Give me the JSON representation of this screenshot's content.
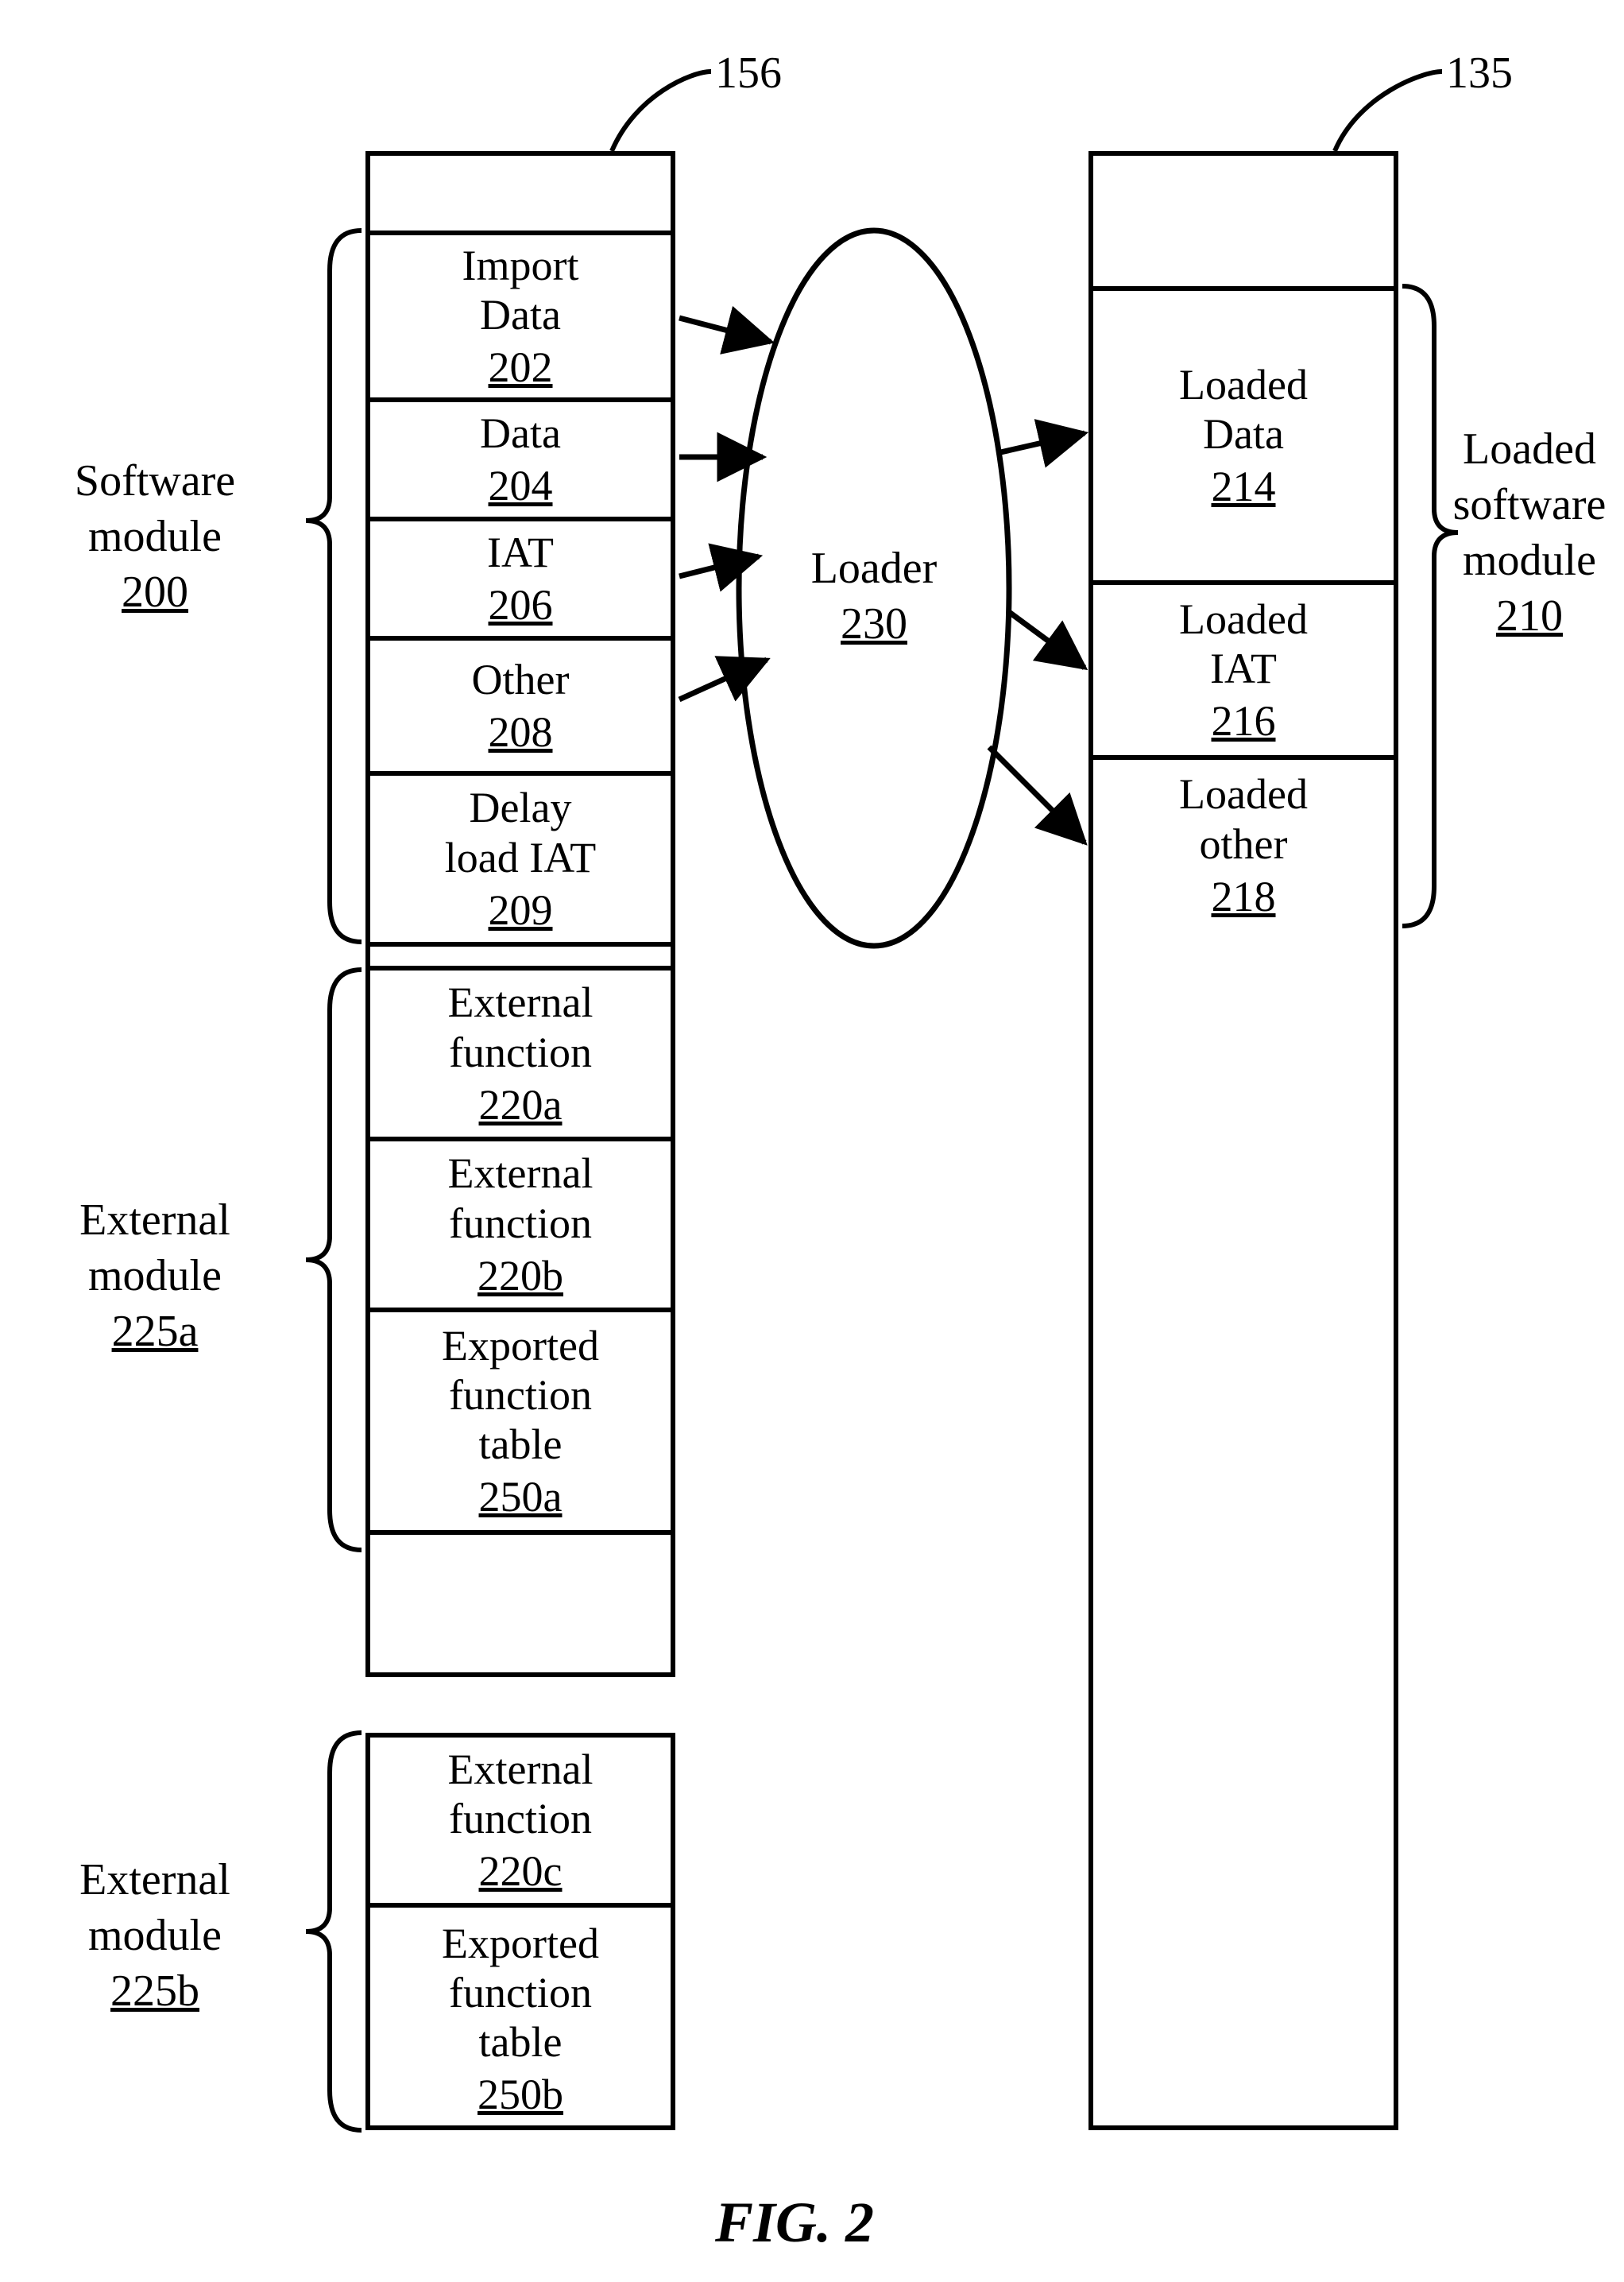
{
  "figure_label": "FIG. 2",
  "callouts": {
    "left_top": "156",
    "right_top": "135"
  },
  "loader": {
    "label": "Loader",
    "ref": "230"
  },
  "side_labels": {
    "software_module": {
      "text": "Software\nmodule",
      "ref": "200"
    },
    "external_module_a": {
      "text": "External\nmodule",
      "ref": "225a"
    },
    "external_module_b": {
      "text": "External\nmodule",
      "ref": "225b"
    },
    "loaded_software_module": {
      "text": "Loaded\nsoftware\nmodule",
      "ref": "210"
    }
  },
  "left_column": {
    "sw": [
      {
        "label": "Import\nData",
        "ref": "202"
      },
      {
        "label": "Data",
        "ref": "204"
      },
      {
        "label": "IAT",
        "ref": "206"
      },
      {
        "label": "Other",
        "ref": "208"
      },
      {
        "label": "Delay\nload IAT",
        "ref": "209"
      }
    ],
    "ext_a": [
      {
        "label": "External\nfunction",
        "ref": "220a"
      },
      {
        "label": "External\nfunction",
        "ref": "220b"
      },
      {
        "label": "Exported\nfunction\ntable",
        "ref": "250a"
      }
    ],
    "ext_b": [
      {
        "label": "External\nfunction",
        "ref": "220c"
      },
      {
        "label": "Exported\nfunction\ntable",
        "ref": "250b"
      }
    ]
  },
  "right_column": {
    "cells": [
      {
        "label": "Loaded\nData",
        "ref": "214"
      },
      {
        "label": "Loaded\nIAT",
        "ref": "216"
      },
      {
        "label": "Loaded\nother",
        "ref": "218"
      }
    ]
  }
}
